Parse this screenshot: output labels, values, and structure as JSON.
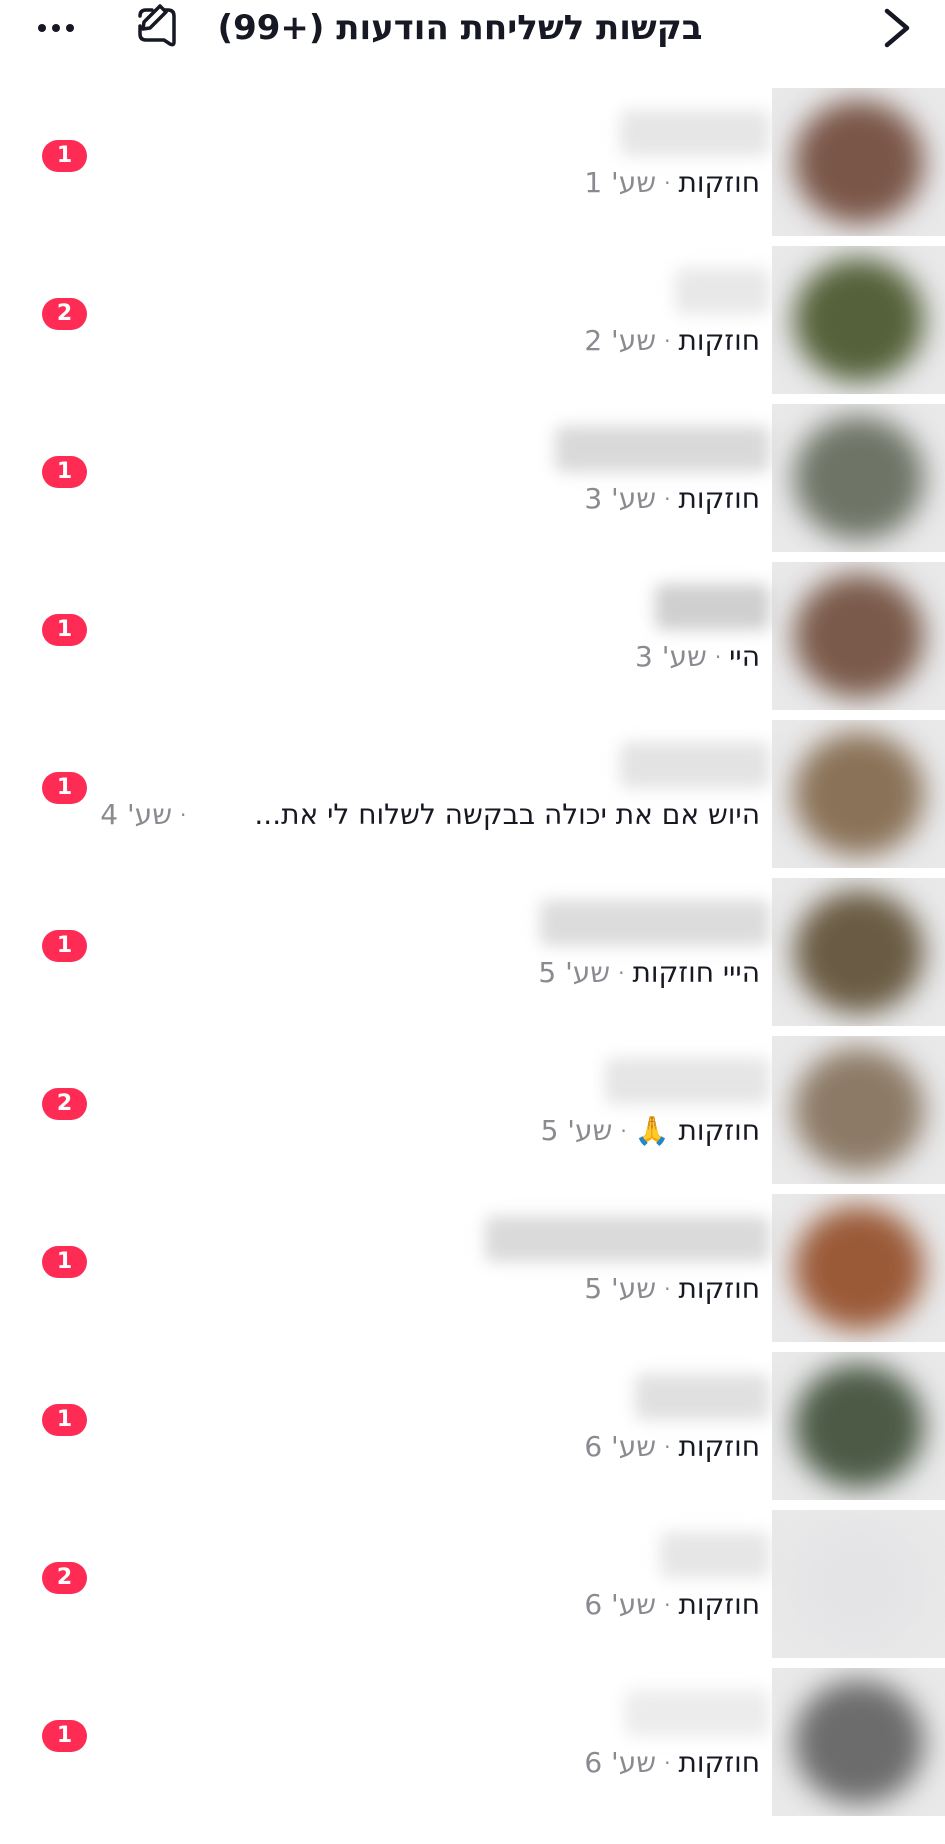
{
  "header": {
    "title": "בקשות לשליחת הודעות (+99)"
  },
  "requests": [
    {
      "message": "חוזקות",
      "time": "שע' 1",
      "badge": "1",
      "avatar_color": "#7a5648",
      "name_color": "#e6e6e6"
    },
    {
      "message": "חוזקות",
      "time": "שע' 2",
      "badge": "2",
      "avatar_color": "#55613a",
      "name_color": "#e8e8e8"
    },
    {
      "message": "חוזקות",
      "time": "שע' 3",
      "badge": "1",
      "avatar_color": "#6e7466",
      "name_color": "#d9d9d9"
    },
    {
      "message": "היי",
      "time": "שע' 3",
      "badge": "1",
      "avatar_color": "#7a5a4a",
      "name_color": "#cfcfcf"
    },
    {
      "message": "היוש אם את יכולה בבקשה לשלוח לי את...",
      "time": "שע' 4",
      "badge": "1",
      "avatar_color": "#8a7258",
      "name_color": "#e3e3e3"
    },
    {
      "message": "הייי חוזקות",
      "time": "שע' 5",
      "badge": "1",
      "avatar_color": "#6a5c44",
      "name_color": "#dcdcdc"
    },
    {
      "message": "חוזקות 🙏",
      "time": "שע' 5",
      "badge": "2",
      "avatar_color": "#8c7a66",
      "name_color": "#e5e5e5"
    },
    {
      "message": "חוזקות",
      "time": "שע' 5",
      "badge": "1",
      "avatar_color": "#9a5a38",
      "name_color": "#dadada"
    },
    {
      "message": "חוזקות",
      "time": "שע' 6",
      "badge": "1",
      "avatar_color": "#4c5a46",
      "name_color": "#e0e0e0"
    },
    {
      "message": "חוזקות",
      "time": "שע' 6",
      "badge": "2",
      "avatar_color": "#e4e4e6",
      "name_color": "#e6e6e6"
    },
    {
      "message": "חוזקות",
      "time": "שע' 6",
      "badge": "1",
      "avatar_color": "#6c6c6c",
      "name_color": "#ececec"
    }
  ],
  "colors": {
    "badge": "#fe2c55",
    "text": "#161823",
    "muted": "#8a8b91"
  },
  "icons": {
    "more": "more-dots-icon",
    "compose": "compose-message-icon",
    "back": "chevron-back-icon"
  }
}
